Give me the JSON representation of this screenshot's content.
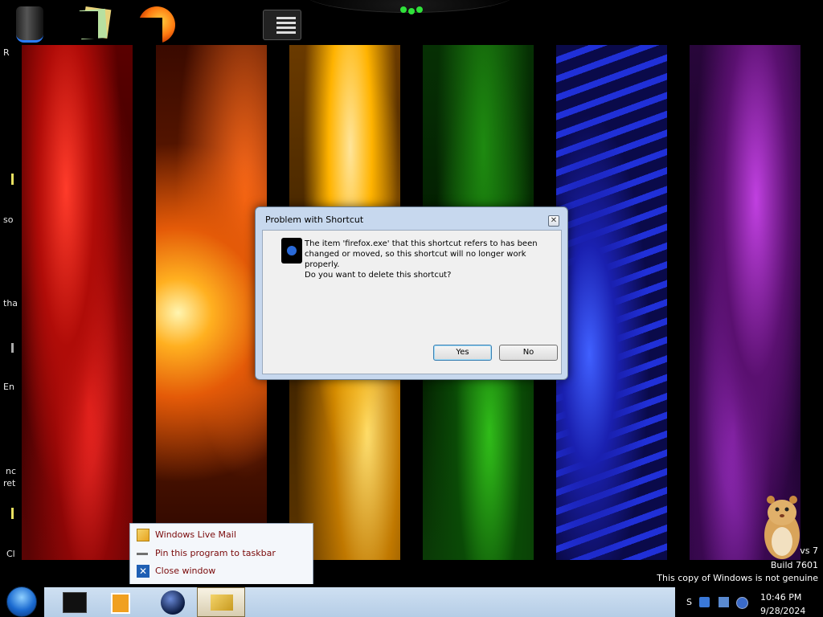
{
  "desktop": {
    "left_fragments": [
      "R",
      "so",
      "tha",
      "En",
      "nc",
      "ret",
      "Cl"
    ]
  },
  "dialog": {
    "title": "Problem with Shortcut",
    "close_glyph": "✕",
    "message_line": "The item 'firefox.exe' that this shortcut refers to has been changed or moved, so this shortcut will no longer work properly.",
    "question": "Do you want to delete this shortcut?",
    "yes_label": "Yes",
    "no_label": "No"
  },
  "jumplist": {
    "items": [
      {
        "label": "Windows Live Mail",
        "icon": "mail-icon"
      },
      {
        "label": "Pin this program to taskbar",
        "icon": "pin-icon"
      },
      {
        "label": "Close window",
        "icon": "close-window-icon"
      }
    ]
  },
  "watermark": {
    "line1": "vs 7",
    "line2": "Build 7601",
    "line3": "This copy of Windows is not genuine"
  },
  "tray": {
    "time": "10:46 PM",
    "date": "9/28/2024",
    "fragment": "S"
  },
  "colors": {
    "dialog_frame": "#c7d8ee",
    "taskbar_strip": "#cfe0f2",
    "jumplist_text": "#7a0a0a"
  }
}
